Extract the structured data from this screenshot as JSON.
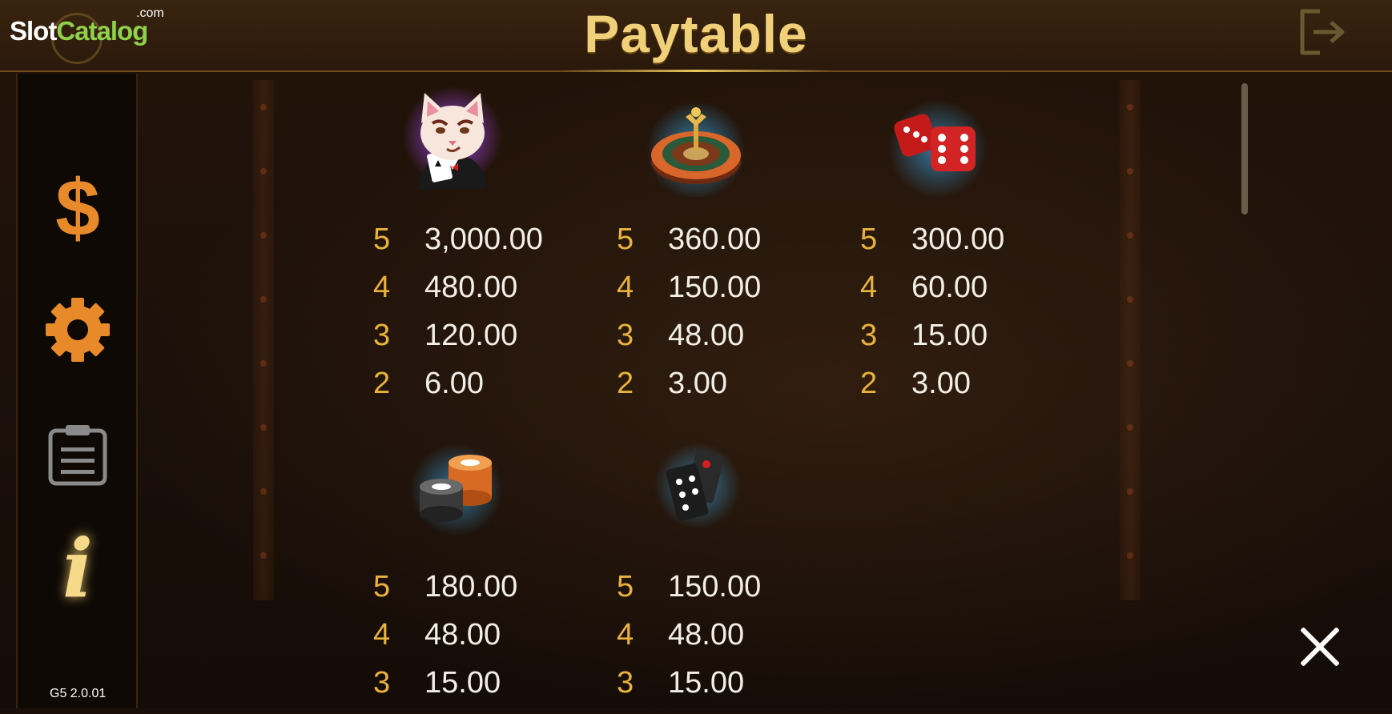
{
  "header": {
    "title": "Paytable",
    "logo": {
      "slot": "Slot",
      "catalog": "Catalog",
      "com": ".com"
    }
  },
  "sidebar": {
    "version": "G5 2.0.01"
  },
  "symbols": [
    {
      "name": "cat-icon",
      "pays": [
        {
          "count": "5",
          "value": "3,000.00"
        },
        {
          "count": "4",
          "value": "480.00"
        },
        {
          "count": "3",
          "value": "120.00"
        },
        {
          "count": "2",
          "value": "6.00"
        }
      ]
    },
    {
      "name": "roulette-icon",
      "pays": [
        {
          "count": "5",
          "value": "360.00"
        },
        {
          "count": "4",
          "value": "150.00"
        },
        {
          "count": "3",
          "value": "48.00"
        },
        {
          "count": "2",
          "value": "3.00"
        }
      ]
    },
    {
      "name": "dice-icon",
      "pays": [
        {
          "count": "5",
          "value": "300.00"
        },
        {
          "count": "4",
          "value": "60.00"
        },
        {
          "count": "3",
          "value": "15.00"
        },
        {
          "count": "2",
          "value": "3.00"
        }
      ]
    },
    {
      "name": "chips-icon",
      "pays": [
        {
          "count": "5",
          "value": "180.00"
        },
        {
          "count": "4",
          "value": "48.00"
        },
        {
          "count": "3",
          "value": "15.00"
        }
      ]
    },
    {
      "name": "dominoes-icon",
      "pays": [
        {
          "count": "5",
          "value": "150.00"
        },
        {
          "count": "4",
          "value": "48.00"
        },
        {
          "count": "3",
          "value": "15.00"
        }
      ]
    }
  ],
  "colors": {
    "accent": "#f1d07a",
    "count": "#e8b23c",
    "value": "#f3efe6",
    "icon_orange": "#e88a2a"
  }
}
